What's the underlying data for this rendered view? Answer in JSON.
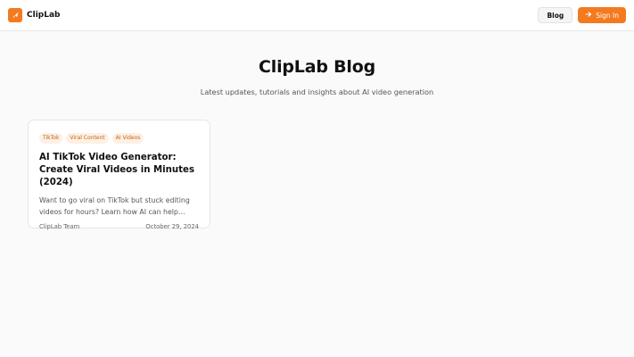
{
  "header": {
    "brand_name": "ClipLab",
    "nav": {
      "blog_label": "Blog",
      "signin_label": "Sign In"
    }
  },
  "hero": {
    "title": "ClipLab Blog",
    "subtitle": "Latest updates, tutorials and insights about AI video generation"
  },
  "posts": [
    {
      "tags": [
        "TikTok",
        "Viral Content",
        "AI Videos"
      ],
      "title": "AI TikTok Video Generator: Create Viral Videos in Minutes (2024)",
      "excerpt": "Want to go viral on TikTok but stuck editing videos for hours? Learn how AI can help you…",
      "author": "ClipLab Team",
      "date": "October 29, 2024"
    }
  ],
  "colors": {
    "accent": "#f47a20",
    "tag_bg": "#fdf0e4",
    "tag_text": "#c46414"
  },
  "icons": {
    "logo": "clapper-rocket-icon",
    "signin": "arrow-right-icon"
  }
}
